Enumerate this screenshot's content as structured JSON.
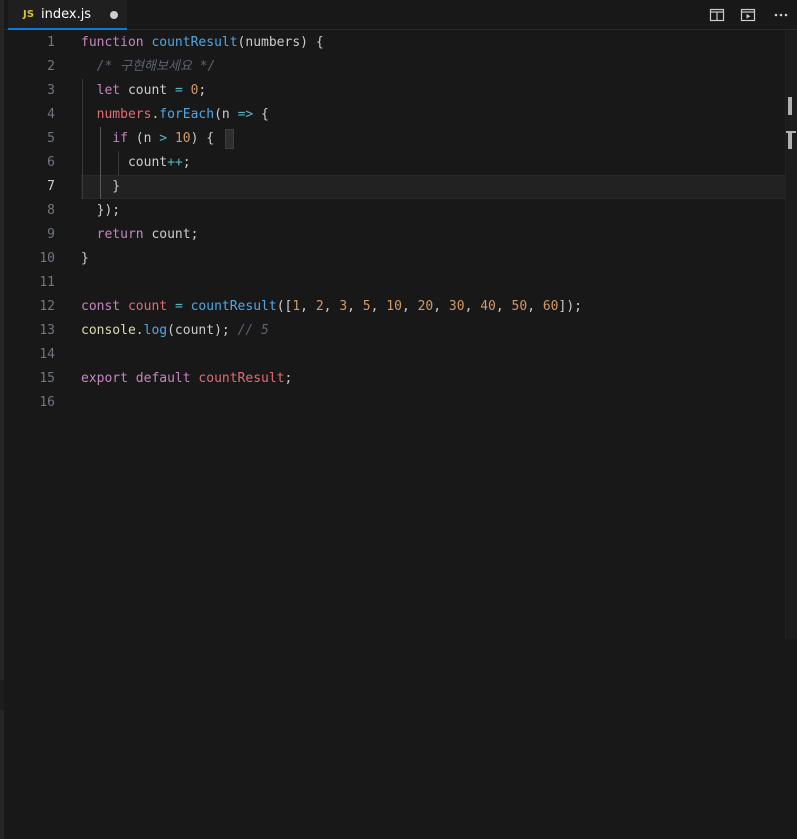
{
  "tab": {
    "icon": "JS",
    "filename": "index.js"
  },
  "toolbar": {
    "actions": [
      "split-editor-icon",
      "open-preview-icon",
      "more-actions-icon"
    ]
  },
  "editor": {
    "active_line": 7,
    "line_numbers": [
      "1",
      "2",
      "3",
      "4",
      "5",
      "6",
      "7",
      "8",
      "9",
      "10",
      "11",
      "12",
      "13",
      "14",
      "15",
      "16"
    ],
    "lines": [
      [
        [
          "kw",
          "function"
        ],
        [
          "pl",
          " "
        ],
        [
          "fn",
          "countResult"
        ],
        [
          "pl",
          "(numbers) {"
        ]
      ],
      [
        [
          "pl",
          "  "
        ],
        [
          "cm",
          "/* 구현해보세요 */"
        ]
      ],
      [
        [
          "pl",
          "  "
        ],
        [
          "kw",
          "let"
        ],
        [
          "pl",
          " count "
        ],
        [
          "op",
          "="
        ],
        [
          "pl",
          " "
        ],
        [
          "num",
          "0"
        ],
        [
          "pl",
          ";"
        ]
      ],
      [
        [
          "pl",
          "  "
        ],
        [
          "vr",
          "numbers"
        ],
        [
          "pl",
          "."
        ],
        [
          "fn",
          "forEach"
        ],
        [
          "pl",
          "(n "
        ],
        [
          "op",
          "=>"
        ],
        [
          "pl",
          " {"
        ]
      ],
      [
        [
          "pl",
          "    "
        ],
        [
          "kw",
          "if"
        ],
        [
          "pl",
          " (n "
        ],
        [
          "op",
          ">"
        ],
        [
          "pl",
          " "
        ],
        [
          "num",
          "10"
        ],
        [
          "pl",
          ") {"
        ]
      ],
      [
        [
          "pl",
          "      count"
        ],
        [
          "op",
          "++"
        ],
        [
          "pl",
          ";"
        ]
      ],
      [
        [
          "pl",
          "    }"
        ]
      ],
      [
        [
          "pl",
          "  });"
        ]
      ],
      [
        [
          "pl",
          "  "
        ],
        [
          "kw",
          "return"
        ],
        [
          "pl",
          " count;"
        ]
      ],
      [
        [
          "pl",
          "}"
        ]
      ],
      [],
      [
        [
          "kw",
          "const"
        ],
        [
          "pl",
          " "
        ],
        [
          "vr",
          "count"
        ],
        [
          "pl",
          " "
        ],
        [
          "op",
          "="
        ],
        [
          "pl",
          " "
        ],
        [
          "fn",
          "countResult"
        ],
        [
          "pl",
          "(["
        ],
        [
          "num",
          "1"
        ],
        [
          "pl",
          ", "
        ],
        [
          "num",
          "2"
        ],
        [
          "pl",
          ", "
        ],
        [
          "num",
          "3"
        ],
        [
          "pl",
          ", "
        ],
        [
          "num",
          "5"
        ],
        [
          "pl",
          ", "
        ],
        [
          "num",
          "10"
        ],
        [
          "pl",
          ", "
        ],
        [
          "num",
          "20"
        ],
        [
          "pl",
          ", "
        ],
        [
          "num",
          "30"
        ],
        [
          "pl",
          ", "
        ],
        [
          "num",
          "40"
        ],
        [
          "pl",
          ", "
        ],
        [
          "num",
          "50"
        ],
        [
          "pl",
          ", "
        ],
        [
          "num",
          "60"
        ],
        [
          "pl",
          "]);"
        ]
      ],
      [
        [
          "var",
          "console"
        ],
        [
          "pl",
          "."
        ],
        [
          "fn",
          "log"
        ],
        [
          "pl",
          "(count); "
        ],
        [
          "cm",
          "// 5"
        ]
      ],
      [],
      [
        [
          "kw",
          "export"
        ],
        [
          "pl",
          " "
        ],
        [
          "kw",
          "default"
        ],
        [
          "pl",
          " "
        ],
        [
          "vr",
          "countResult"
        ],
        [
          "pl",
          ";"
        ]
      ],
      []
    ]
  },
  "colors": {
    "accent": "#0a78d4",
    "keyword": "#c586c0",
    "function": "#4fa7e6",
    "number": "#d19a66",
    "comment": "#5c6370"
  }
}
